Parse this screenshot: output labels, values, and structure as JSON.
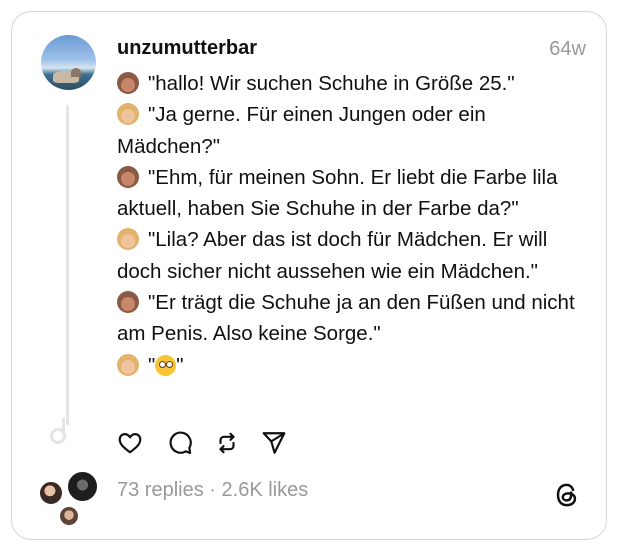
{
  "post": {
    "username": "unzumutterbar",
    "time": "64w",
    "lines": [
      {
        "speaker": "mom",
        "text": "\"hallo! Wir suchen Schuhe in Größe 25.\""
      },
      {
        "speaker": "clerk",
        "text": "\"Ja gerne. Für einen Jungen oder ein Mädchen?\""
      },
      {
        "speaker": "mom",
        "text": "\"Ehm, für meinen Sohn. Er liebt die Farbe lila aktuell, haben Sie Schuhe in der Farbe da?\""
      },
      {
        "speaker": "clerk",
        "text": "\"Lila? Aber das ist doch für Mädchen. Er will doch sicher nicht aussehen wie ein Mädchen.\""
      },
      {
        "speaker": "mom",
        "text": "\"Er trägt die Schuhe ja an den Füßen und nicht am Penis. Also keine Sorge.\""
      },
      {
        "speaker": "clerk",
        "text_open": "\"",
        "text_close": "\"",
        "emoji": "flushed-face"
      }
    ]
  },
  "actions": {
    "like_icon": "heart-icon",
    "reply_icon": "comment-icon",
    "repost_icon": "repost-icon",
    "share_icon": "send-icon"
  },
  "stats": {
    "replies": "73 replies",
    "separator": "·",
    "likes": "2.6K likes"
  },
  "brand": {
    "logo_icon": "threads-logo-icon",
    "text_color": "#101010",
    "muted_color": "#999999",
    "border_color": "#d6d6d6"
  }
}
